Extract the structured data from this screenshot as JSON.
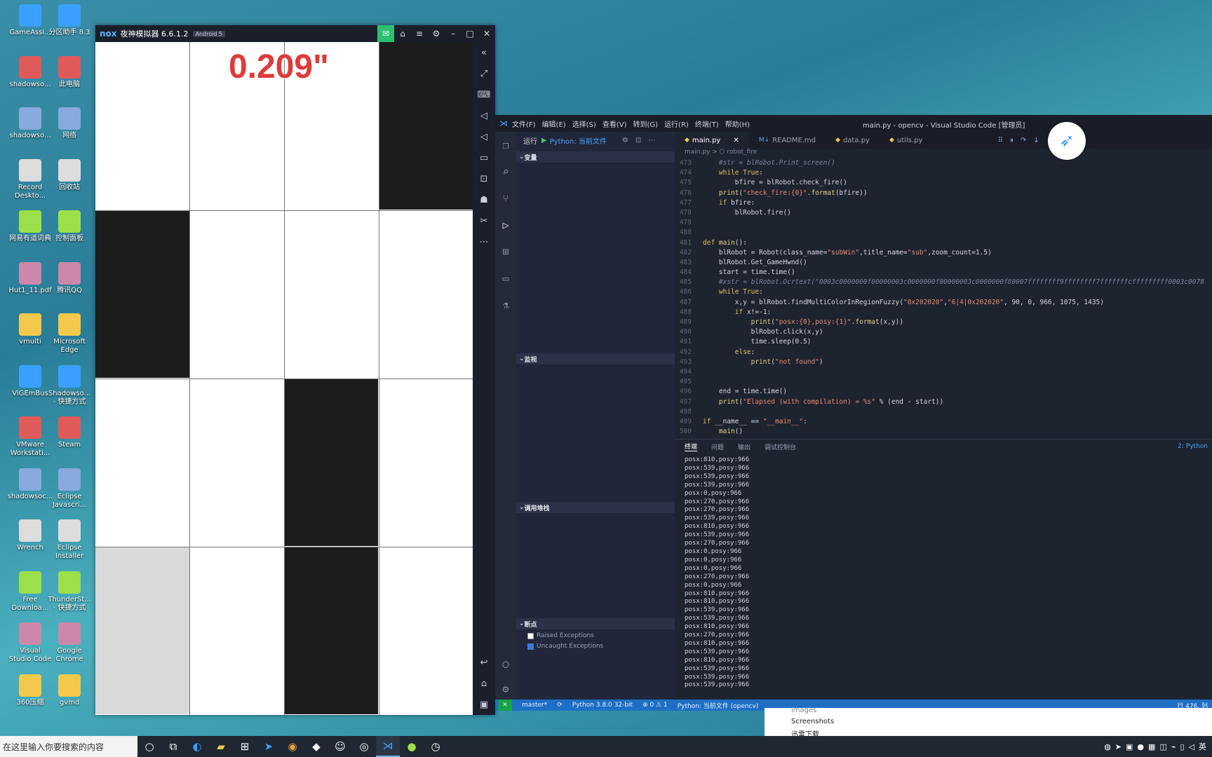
{
  "desktop": {
    "col1": [
      "GameAssi...",
      "shadowso...",
      "shadowso...",
      "Record\nDeskto...",
      "网易有道词典",
      "Hut1_11.pdf",
      "vmulti",
      "ViGEmBus",
      "VMware\nWorkstati...",
      "shadowsoc...",
      "Wrench",
      "Free\nDownloa...",
      "Visual\nStudio Code",
      "360压缩"
    ],
    "col2": [
      "分区助手 8.3",
      "此电脑",
      "网络",
      "回收站",
      "控制面板",
      "腾讯QQ",
      "Microsoft\nEdge",
      "Shadowso...\n- 快捷方式",
      "Steam",
      "Eclipse\nJavascri...",
      "Eclipse\nInstaller",
      "ThunderSt...\n- 快捷方式",
      "Google\nChrome",
      "gvmd"
    ]
  },
  "emulator": {
    "logo": "nox",
    "title": "夜神模拟器 6.6.1.2",
    "badge": "Android 5",
    "timer": "0.209\"",
    "tiles": [
      [
        "w",
        "w",
        "w",
        "b"
      ],
      [
        "b",
        "w",
        "w",
        "w"
      ],
      [
        "w",
        "w",
        "b",
        "w"
      ],
      [
        "g",
        "w",
        "b",
        "w"
      ]
    ]
  },
  "vscode": {
    "menu": [
      "文件(F)",
      "编辑(E)",
      "选择(S)",
      "查看(V)",
      "转到(G)",
      "运行(R)",
      "终端(T)",
      "帮助(H)"
    ],
    "window_title": "main.py - opencv - Visual Studio Code [管理员]",
    "run_label": "运行",
    "run_config": "Python: 当前文件",
    "sections": {
      "variables": "变量",
      "watch": "监视",
      "callstack": "调用堆栈",
      "breakpoints": "断点"
    },
    "breakpoints": [
      "Raised Exceptions",
      "Uncaught Exceptions"
    ],
    "tabs": [
      "main.py",
      "README.md",
      "data.py",
      "utils.py"
    ],
    "breadcrumb": "main.py > ⬡ robot_fire",
    "code": [
      {
        "n": "473",
        "t": "    #str = blRobot.Print_screen()"
      },
      {
        "n": "474",
        "t": "    while True:"
      },
      {
        "n": "475",
        "t": "        bfire = blRobot.check_fire()"
      },
      {
        "n": "476",
        "t": "    print(\"check_fire:{0}\".format(bfire))"
      },
      {
        "n": "477",
        "t": "    if bfire:"
      },
      {
        "n": "478",
        "t": "        blRobot.fire()"
      },
      {
        "n": "479",
        "t": ""
      },
      {
        "n": "480",
        "t": ""
      },
      {
        "n": "481",
        "t": "def main():"
      },
      {
        "n": "482",
        "t": "    blRobot = Robot(class_name=\"subWin\",title_name=\"sub\",zoom_count=1.5)"
      },
      {
        "n": "483",
        "t": "    blRobot.Get_GameHwnd()"
      },
      {
        "n": "484",
        "t": "    start = time.time()"
      },
      {
        "n": "485",
        "t": "    #xstr = blRobot.Ocrtext(\"0003c0000000f00000003c0000000f00000003c0000000f80007ffffffff9ffffffff7fffffffcfffffffff0003c0078"
      },
      {
        "n": "486",
        "t": "    while True:"
      },
      {
        "n": "487",
        "t": "        x,y = blRobot.findMultiColorInRegionFuzzy(\"0x202020\",\"6|4|0x202020\", 90, 0, 966, 1075, 1435)"
      },
      {
        "n": "488",
        "t": "        if x!=-1:"
      },
      {
        "n": "489",
        "t": "            print(\"posx:{0},posy:{1}\".format(x,y))"
      },
      {
        "n": "490",
        "t": "            blRobot.click(x,y)"
      },
      {
        "n": "491",
        "t": "            time.sleep(0.5)"
      },
      {
        "n": "492",
        "t": "        else:"
      },
      {
        "n": "493",
        "t": "            print(\"not found\")"
      },
      {
        "n": "494",
        "t": ""
      },
      {
        "n": "495",
        "t": ""
      },
      {
        "n": "496",
        "t": "    end = time.time()"
      },
      {
        "n": "497",
        "t": "    print(\"Elapsed (with compilation) = %s\" % (end - start))"
      },
      {
        "n": "498",
        "t": ""
      },
      {
        "n": "499",
        "t": "if __name__ == \"__main__\":"
      },
      {
        "n": "500",
        "t": "    main()"
      }
    ],
    "panel_tabs": [
      "终端",
      "问题",
      "输出",
      "调试控制台"
    ],
    "panel_right": "2: Python",
    "terminal": [
      "posx:810,posy:966",
      "posx:539,posy:966",
      "posx:539,posy:966",
      "posx:539,posy:966",
      "posx:0,posy:966",
      "posx:270,posy:966",
      "posx:270,posy:966",
      "posx:539,posy:966",
      "posx:810,posy:966",
      "posx:539,posy:966",
      "posx:270,posy:966",
      "posx:0,posy:966",
      "posx:0,posy:966",
      "posx:0,posy:966",
      "posx:270,posy:966",
      "posx:0,posy:966",
      "posx:810,posy:966",
      "posx:810,posy:966",
      "posx:539,posy:966",
      "posx:539,posy:966",
      "posx:810,posy:966",
      "posx:270,posy:966",
      "posx:810,posy:966",
      "posx:539,posy:966",
      "posx:810,posy:966",
      "posx:539,posy:966",
      "posx:539,posy:966",
      "posx:539,posy:966"
    ],
    "status": {
      "branch": "master*",
      "python": "Python 3.8.0 32-bit",
      "problems": "⊗ 0 ⚠ 1",
      "run": "Python: 当前文件 (opencv)",
      "position": "行 476, 列"
    }
  },
  "explorer": {
    "items": [
      "images",
      "Screenshots",
      "迅雷下载"
    ]
  },
  "taskbar": {
    "search_placeholder": "在这里输入你要搜索的内容"
  },
  "tray": {
    "lang": "英"
  }
}
